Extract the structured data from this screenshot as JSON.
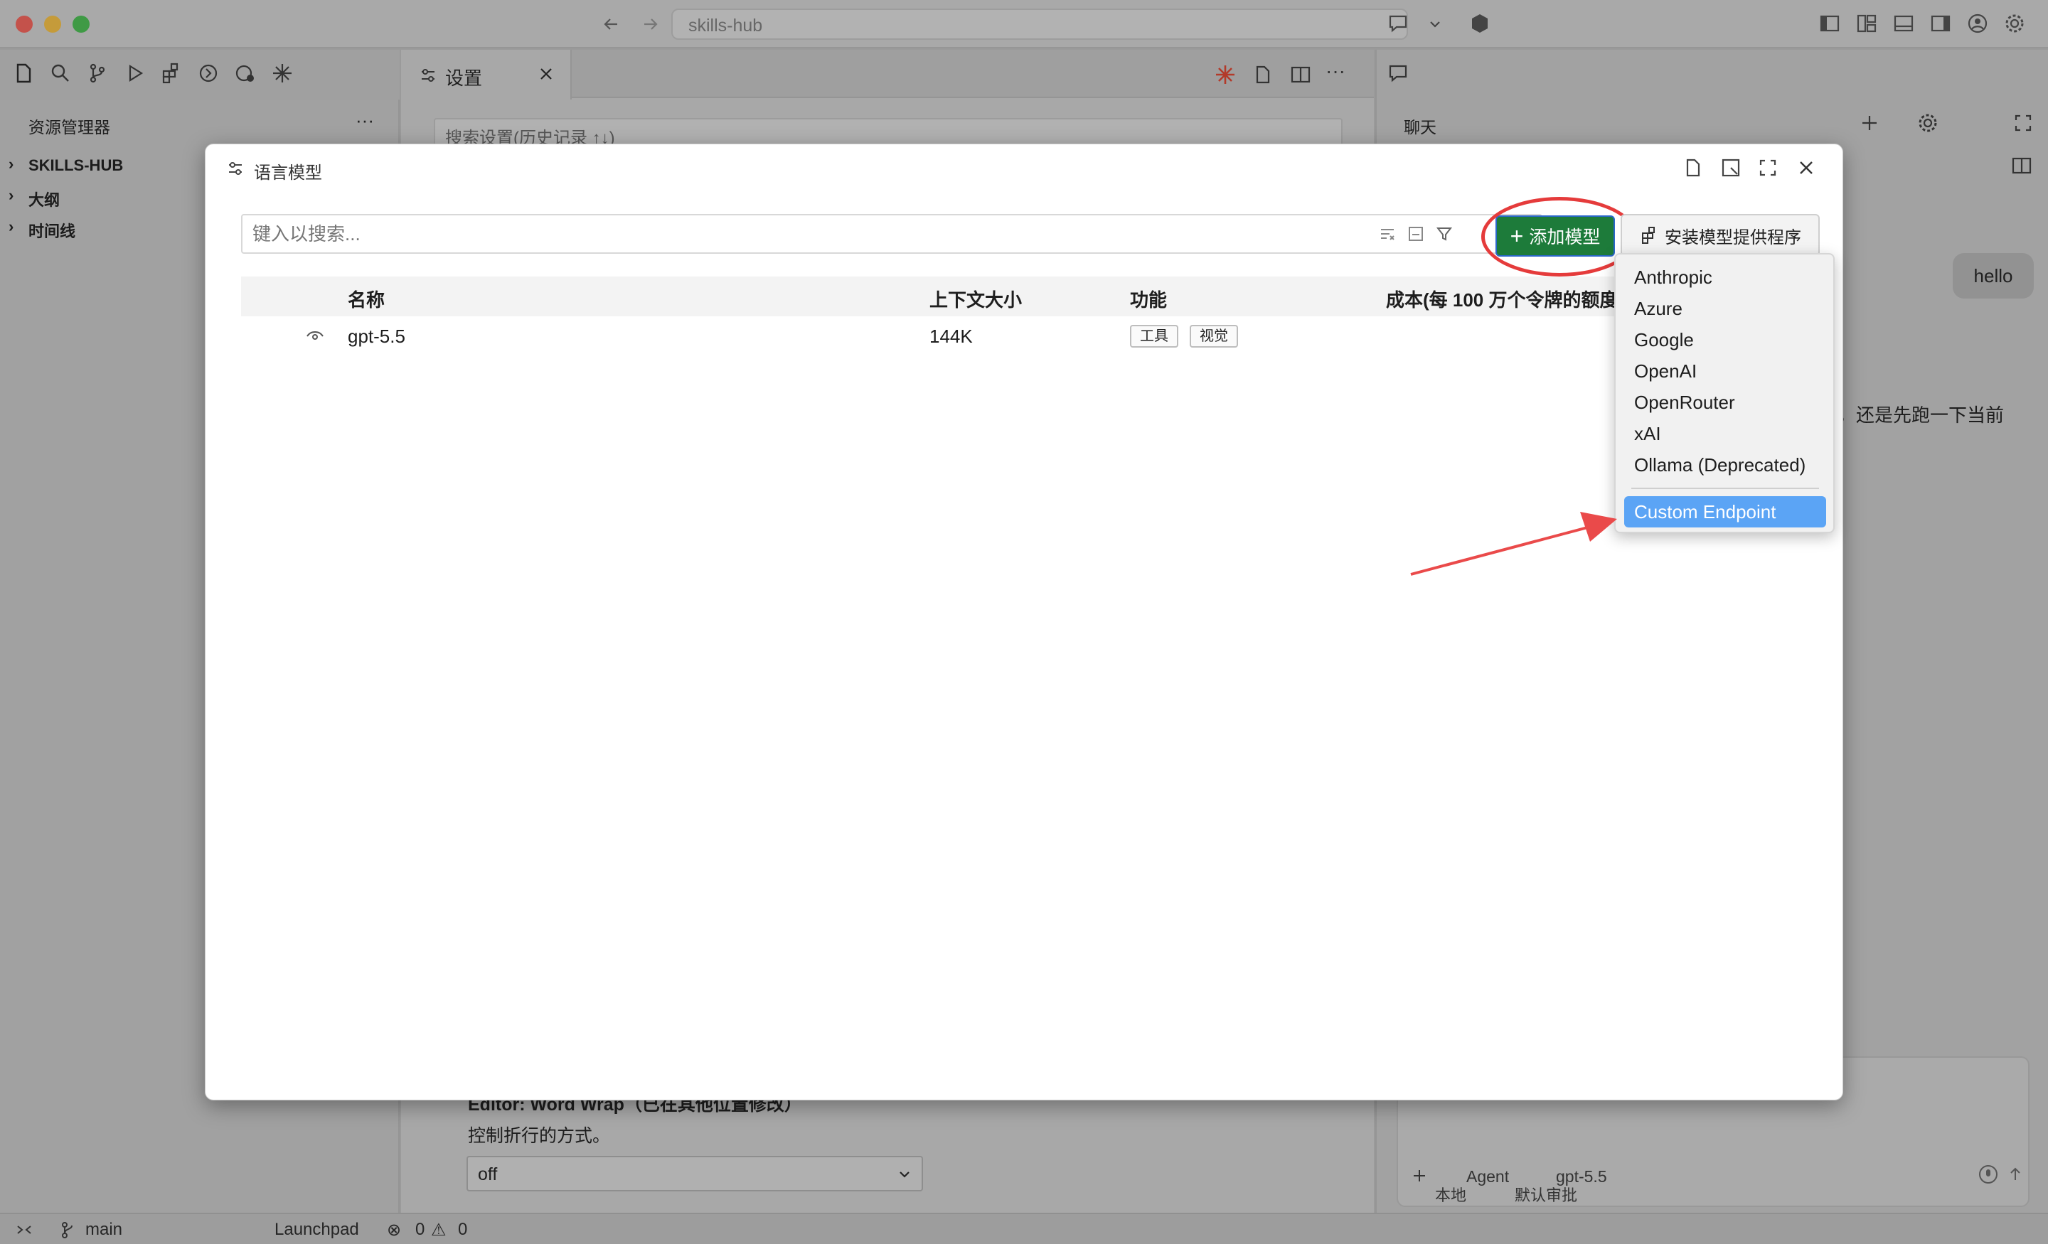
{
  "window": {
    "address_text": "skills-hub"
  },
  "sidebar": {
    "title": "资源管理器",
    "more": "···",
    "tree": [
      {
        "label": "SKILLS-HUB"
      },
      {
        "label": "大纲"
      },
      {
        "label": "时间线"
      }
    ]
  },
  "editor": {
    "tab_label": "设置",
    "settings_search_placeholder": "搜索设置(历史记录 ↑↓)",
    "setting_title": "Editor: Word Wrap（已在其他位置修改）",
    "setting_desc": "控制折行的方式。",
    "setting_value": "off"
  },
  "chat": {
    "title": "聊天",
    "message": "hello",
    "partial_text": "，还是先跑一下当前",
    "mode": "Agent",
    "model": "gpt-5.5",
    "location": "本地",
    "approval": "默认审批"
  },
  "statusbar": {
    "branch": "main",
    "launchpad": "Launchpad",
    "errors": "0",
    "warnings": "0"
  },
  "dialog": {
    "title": "语言模型",
    "search_placeholder": "键入以搜索...",
    "add_model_label": "添加模型",
    "install_provider_label": "安装模型提供程序",
    "columns": {
      "name": "名称",
      "context": "上下文大小",
      "capabilities": "功能",
      "cost": "成本(每 100 万个令牌的额度"
    },
    "rows": [
      {
        "name": "gpt-5.5",
        "context": "144K",
        "tags": [
          "工具",
          "视觉"
        ]
      }
    ]
  },
  "dropdown": {
    "items": [
      "Anthropic",
      "Azure",
      "Google",
      "OpenAI",
      "OpenRouter",
      "xAI",
      "Ollama (Deprecated)"
    ],
    "selected": "Custom Endpoint"
  },
  "colors": {
    "accent_green": "#1d7b3a",
    "selection_blue": "#5ba4f5",
    "highlight_red": "#e53b3b"
  }
}
